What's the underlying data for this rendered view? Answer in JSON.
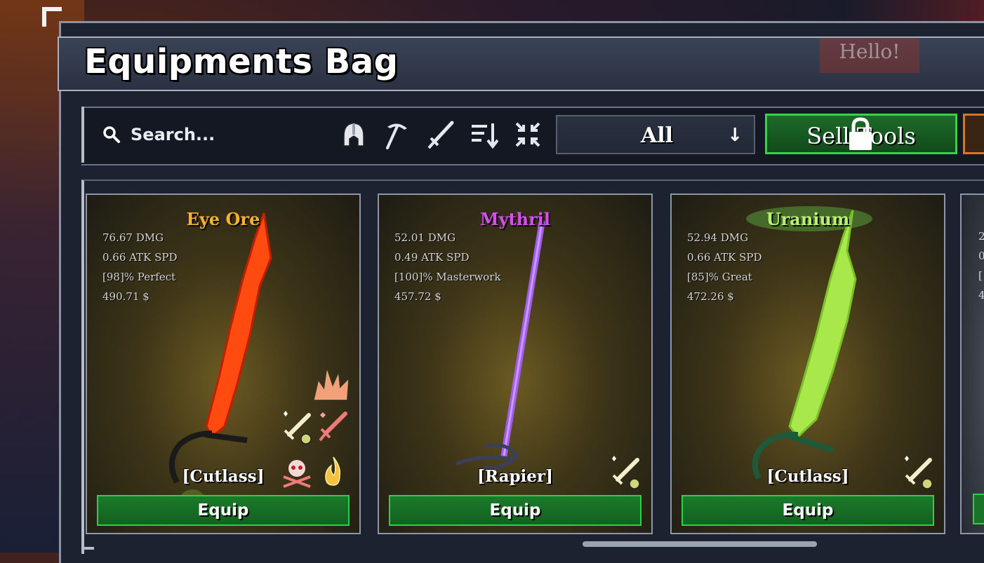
{
  "header": {
    "title": "Equipments Bag",
    "hello": "Hello!"
  },
  "toolbar": {
    "search_placeholder": "Search...",
    "filter_icons": [
      "helmet-icon",
      "pickaxe-icon",
      "sword-icon",
      "sort-icon",
      "collapse-icon"
    ],
    "dropdown_value": "All",
    "sell_label": "Sell Tools"
  },
  "cards": [
    {
      "name": "Eye Ore",
      "name_color": "#f5b130",
      "dmg": "76.67 DMG",
      "atk_spd": "0.66 ATK SPD",
      "quality": "[98]% Perfect",
      "price": "490.71 $",
      "type": "[Cutlass]",
      "equip": "Equip",
      "perks": [
        "explosion-icon",
        "sword-sparkle-icon",
        "sword-red-icon",
        "skull-crossbones-icon",
        "flame-icon"
      ]
    },
    {
      "name": "Mythril",
      "name_color": "#d64ef0",
      "dmg": "52.01 DMG",
      "atk_spd": "0.49 ATK SPD",
      "quality": "[100]% Masterwork",
      "price": "457.72 $",
      "type": "[Rapier]",
      "equip": "Equip",
      "perks": [
        "sword-sparkle-icon"
      ]
    },
    {
      "name": "Uranium",
      "name_color": "#b8f070",
      "dmg": "52.94 DMG",
      "atk_spd": "0.66 ATK SPD",
      "quality": "[85]% Great",
      "price": "472.26 $",
      "type": "[Cutlass]",
      "equip": "Equip",
      "perks": [
        "sword-sparkle-icon"
      ]
    }
  ],
  "partial_card": {
    "lines": [
      "2",
      "0",
      "[",
      "4"
    ]
  },
  "colors": {
    "equip_green": "#1c7a2a",
    "accent_border": "#2ed04a",
    "panel": "#1c2230"
  }
}
